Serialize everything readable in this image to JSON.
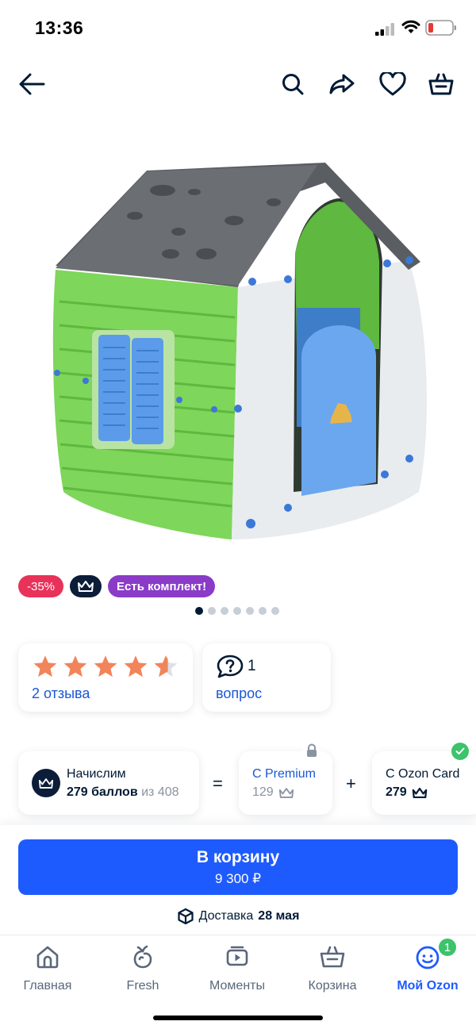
{
  "status_bar": {
    "time": "13:36"
  },
  "badges": {
    "discount": "-35%",
    "kit": "Есть комплект!"
  },
  "gallery": {
    "total_images": 7,
    "active_index": 0
  },
  "rating": {
    "stars": 4.5,
    "reviews_text": "2 отзыва"
  },
  "questions": {
    "count": "1",
    "label": "вопрос"
  },
  "bonus": {
    "title": "Начислим",
    "amount": "279 баллов",
    "of_text": "из 408",
    "equals": "=",
    "plus": "+",
    "premium_title": "С Premium",
    "premium_value": "129",
    "ozon_card_title": "С Ozon Card",
    "ozon_card_value": "279"
  },
  "cart": {
    "label": "В корзину",
    "price": "9 300 ₽"
  },
  "delivery": {
    "prefix": "Доставка",
    "date": "28 мая"
  },
  "tabs": [
    {
      "label": "Главная",
      "icon": "home-icon"
    },
    {
      "label": "Fresh",
      "icon": "fresh-icon"
    },
    {
      "label": "Моменты",
      "icon": "moments-icon"
    },
    {
      "label": "Корзина",
      "icon": "basket-icon"
    },
    {
      "label": "Мой Ozon",
      "icon": "profile-icon"
    }
  ],
  "tab_badge": "1",
  "colors": {
    "accent": "#1e5bff",
    "link": "#1a57d6",
    "discount": "#e8325a",
    "kit": "#8a3bc7",
    "success": "#3cc36b",
    "star": "#f2845a"
  }
}
